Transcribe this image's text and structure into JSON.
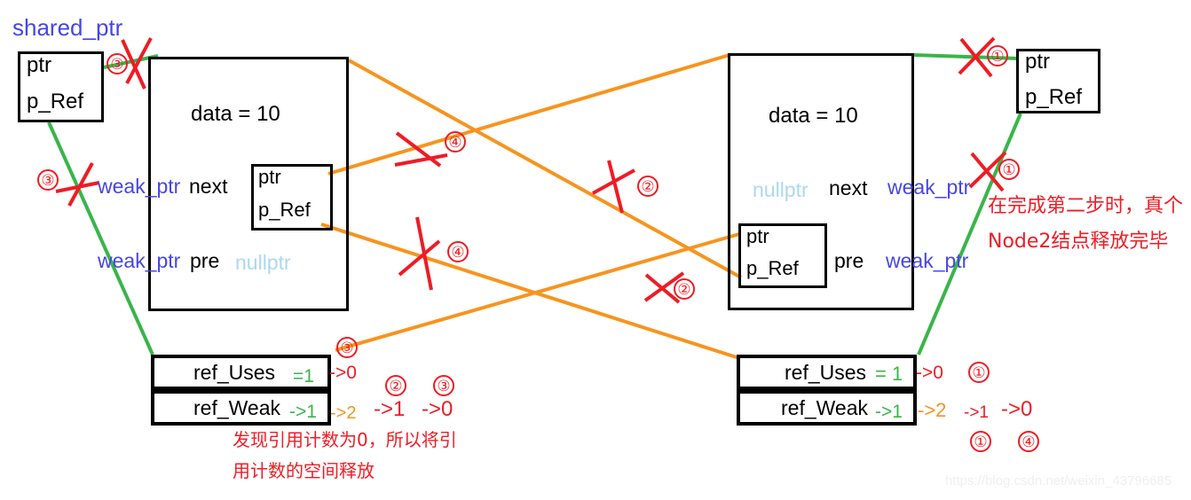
{
  "diagram": {
    "title_label": "shared_ptr",
    "watermark": "https://blog.csdn.net/weixin_43796685"
  },
  "shared_ptr_box_left": {
    "line1": "ptr",
    "line2": "p_Ref"
  },
  "shared_ptr_box_right": {
    "line1": "ptr",
    "line2": "p_Ref"
  },
  "node1": {
    "data_label": "data = 10",
    "next_owner": "weak_ptr",
    "next_label": "next",
    "pre_owner": "weak_ptr",
    "pre_label": "pre",
    "pre_value": "nullptr",
    "inner_ptr_box": {
      "line1": "ptr",
      "line2": "p_Ref"
    }
  },
  "node2": {
    "data_label": "data = 10",
    "next_value": "nullptr",
    "next_label": "next",
    "next_owner": "weak_ptr",
    "pre_label": "pre",
    "pre_owner": "weak_ptr",
    "inner_ptr_box": {
      "line1": "ptr",
      "line2": "p_Ref"
    }
  },
  "ref_block_left": {
    "uses_label": "ref_Uses",
    "uses_value": "=1",
    "uses_next": "->0",
    "uses_marker": "③",
    "weak_label": "ref_Weak",
    "weak_value": "->1",
    "weak_step1": "->2",
    "weak_step2": "->1",
    "weak_step3": "->0",
    "weak_marker2": "②",
    "weak_marker3": "③",
    "note_line1": "发现引用计数为0，所以将引",
    "note_line2": "用计数的空间释放"
  },
  "ref_block_right": {
    "uses_label": "ref_Uses",
    "uses_value": "= 1",
    "uses_next": "->0",
    "uses_marker": "①",
    "weak_label": "ref_Weak",
    "weak_value": "->1",
    "weak_step1": "->2",
    "weak_step2": "->1",
    "weak_step3": "->0",
    "weak_marker2": "①",
    "weak_marker3": "④"
  },
  "note_right": {
    "line1": "在完成第二步时，真个",
    "line2": "Node2结点释放完毕"
  },
  "step_markers": [
    {
      "id": "m-left-top",
      "text": "③"
    },
    {
      "id": "m-left-mid",
      "text": "③"
    },
    {
      "id": "m-center-upper",
      "text": "④"
    },
    {
      "id": "m-center-right-upper",
      "text": "②"
    },
    {
      "id": "m-center-lower",
      "text": "④"
    },
    {
      "id": "m-center-right-lower",
      "text": "②"
    },
    {
      "id": "m-right-top",
      "text": "①"
    },
    {
      "id": "m-right-mid",
      "text": "①"
    }
  ],
  "colors": {
    "shared_ptr": "#4646e6",
    "weak_ptr": "#4646e6",
    "nullptr": "#add9ee",
    "green_link": "#39b54a",
    "orange_link": "#f7941e",
    "red_cross": "#ee1c25",
    "black": "#000000"
  }
}
